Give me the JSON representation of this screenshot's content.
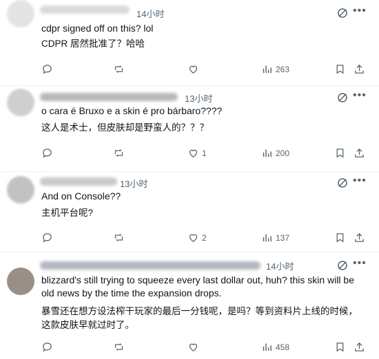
{
  "posts": [
    {
      "handle_suffix": "",
      "time": "14小时",
      "text": "cdpr signed off on this? lol",
      "translation": "CDPR 居然批准了？哈哈",
      "replies": "",
      "likes": "",
      "views": "263"
    },
    {
      "handle_suffix": "·",
      "time": "13小时",
      "text": "o cara é Bruxo e a skin é pro bárbaro????",
      "translation": "这人是术士，但皮肤却是野蛮人的？？？",
      "replies": "",
      "likes": "1",
      "views": "200"
    },
    {
      "handle_suffix": "·",
      "time": "13小时",
      "text": "And on Console??",
      "translation": "主机平台呢?",
      "replies": "",
      "likes": "2",
      "views": "137"
    },
    {
      "handle_suffix": "·",
      "time": "14小时",
      "text": "blizzard's still trying to squeeze every last dollar out, huh? this skin will be old news by the time the expansion drops.",
      "translation": "暴雪还在想方设法榨干玩家的最后一分钱呢，是吗？等到资料片上线的时候，这款皮肤早就过时了。",
      "replies": "",
      "likes": "",
      "views": "458"
    }
  ],
  "icons": {
    "reply": "reply-icon",
    "repost": "repost-icon",
    "like": "heart-icon",
    "views": "views-icon",
    "bookmark": "bookmark-icon",
    "share": "share-icon",
    "grok": "grok-icon",
    "more": "more-icon"
  },
  "colors": {
    "text": "#0f1419",
    "secondary": "#536471",
    "divider": "#eff3f4"
  }
}
